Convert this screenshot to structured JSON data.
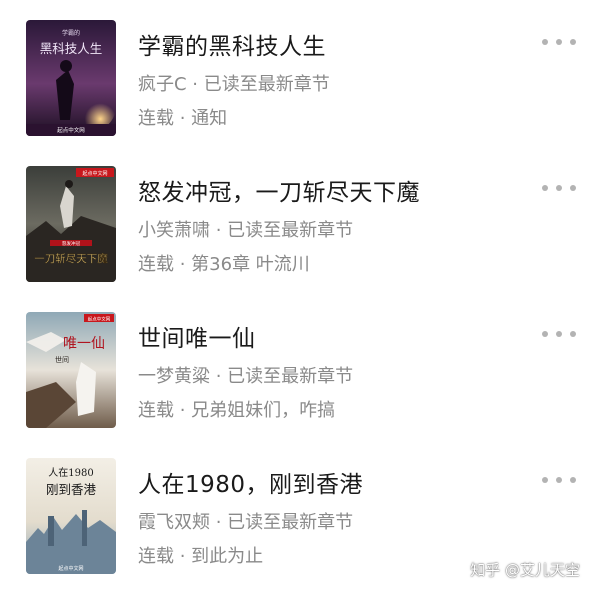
{
  "books": [
    {
      "title": "学霸的黑科技人生",
      "author": "疯子C",
      "read_status": "已读至最新章节",
      "serial_status": "连载",
      "update": "通知",
      "cover_text": "黑科技人生",
      "cover_top": "学霸的",
      "cover_publisher": "起点中文网"
    },
    {
      "title": "怒发冲冠，一刀斩尽天下魔",
      "author": "小笑萧啸",
      "read_status": "已读至最新章节",
      "serial_status": "连载",
      "update": "第36章 叶流川",
      "cover_text": "一刀斩尽天下魔",
      "cover_top": "怒发冲冠",
      "cover_publisher": "起点中文网"
    },
    {
      "title": "世间唯一仙",
      "author": "一梦黄粱",
      "read_status": "已读至最新章节",
      "serial_status": "连载",
      "update": "兄弟姐妹们，咋搞",
      "cover_text": "唯一仙",
      "cover_top": "世间",
      "cover_publisher": "起点中文网"
    },
    {
      "title": "人在1980，刚到香港",
      "author": "霞飞双颊",
      "read_status": "已读至最新章节",
      "serial_status": "连载",
      "update": "到此为止",
      "cover_text": "刚到香港",
      "cover_top": "人在1980",
      "cover_publisher": "起点中文网"
    }
  ],
  "separator": " · ",
  "watermark": "知乎 @艾儿天空"
}
